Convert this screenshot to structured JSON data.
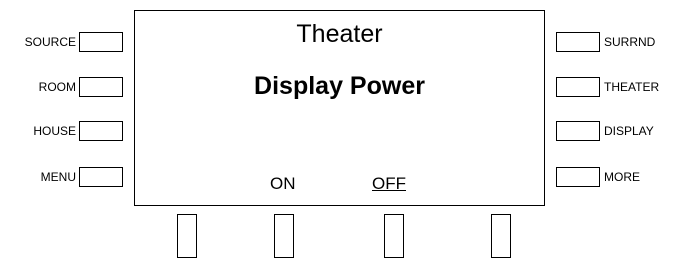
{
  "screen": {
    "title": "Theater",
    "heading": "Display Power",
    "softkeys": [
      "ON",
      "OFF"
    ]
  },
  "left_buttons": [
    "SOURCE",
    "ROOM",
    "HOUSE",
    "MENU"
  ],
  "right_buttons": [
    "SURRND",
    "THEATER",
    "DISPLAY",
    "MORE"
  ]
}
